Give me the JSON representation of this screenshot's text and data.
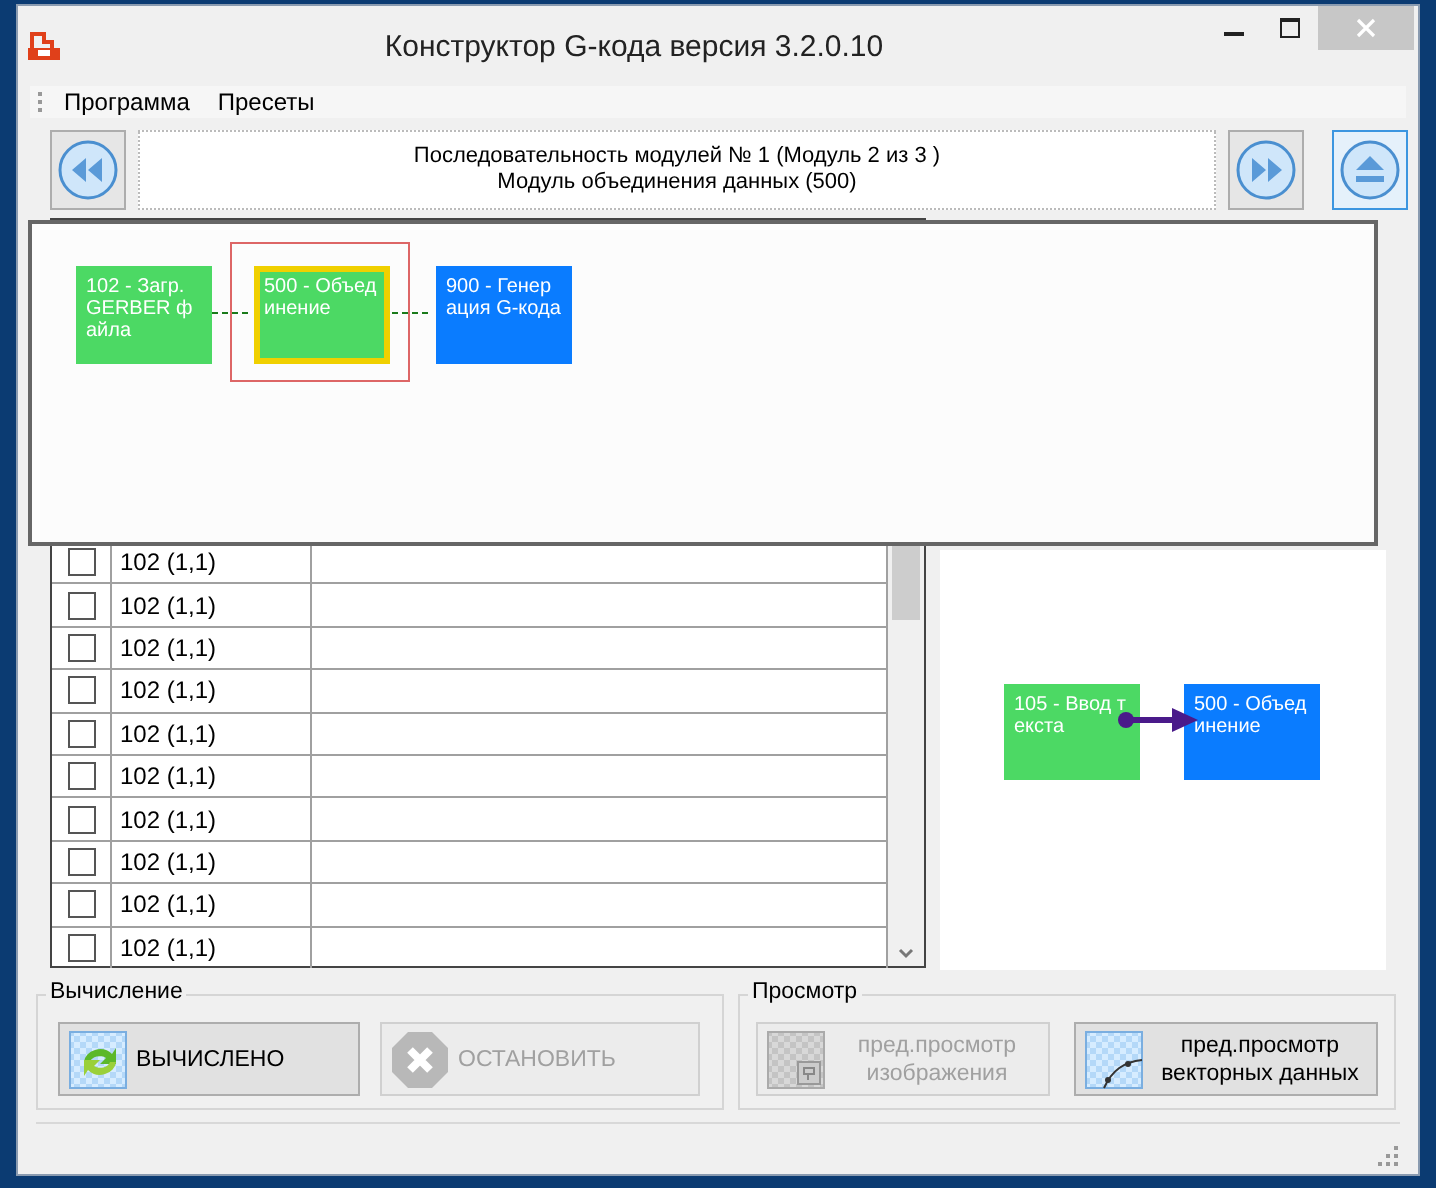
{
  "window": {
    "title": "Конструктор G-кода версия 3.2.0.10"
  },
  "menu": [
    {
      "label": "Программа"
    },
    {
      "label": "Пресеты"
    }
  ],
  "sequence": {
    "line1": "Последовательность модулей № 1 (Модуль 2 из 3 )",
    "line2": "Модуль объединения данных (500)"
  },
  "grid": {
    "rows": [
      {
        "checked": false,
        "source": "102 (1,1)"
      },
      {
        "checked": false,
        "source": "102 (1,1)"
      },
      {
        "checked": false,
        "source": "102 (1,1)"
      },
      {
        "checked": false,
        "source": "102 (1,1)"
      },
      {
        "checked": false,
        "source": "102 (1,1)"
      },
      {
        "checked": false,
        "source": "102 (1,1)"
      },
      {
        "checked": false,
        "source": "102 (1,1)"
      },
      {
        "checked": false,
        "source": "102 (1,1)"
      },
      {
        "checked": false,
        "source": "102 (1,1)"
      },
      {
        "checked": false,
        "source": "102 (1,1)"
      }
    ]
  },
  "preview": {
    "nodes": [
      {
        "label": "105 - Ввод текста",
        "color": "#4cd964"
      },
      {
        "label": "500 - Объединение",
        "color": "#0a7cff"
      }
    ]
  },
  "sequence_popup": {
    "modules": [
      {
        "label": "102 - Загр. GERBER файла",
        "color": "#4cd964",
        "selected": false
      },
      {
        "label": "500 - Объединение",
        "color": "#4cd964",
        "selected": true
      },
      {
        "label": "900 - Генерация G-кода",
        "color": "#0a7cff",
        "selected": false
      }
    ]
  },
  "compute_group": {
    "title": "Вычисление",
    "buttons": [
      {
        "label": "ВЫЧИСЛЕНО",
        "kind": "compute",
        "disabled": false
      },
      {
        "label": "ОСТАНОВИТЬ",
        "kind": "stop",
        "disabled": true
      }
    ]
  },
  "view_group": {
    "title": "Просмотр",
    "buttons": [
      {
        "label": "пред.просмотр изображения",
        "kind": "image",
        "disabled": true
      },
      {
        "label": "пред.просмотр векторных данных",
        "kind": "vector",
        "disabled": false
      }
    ]
  }
}
